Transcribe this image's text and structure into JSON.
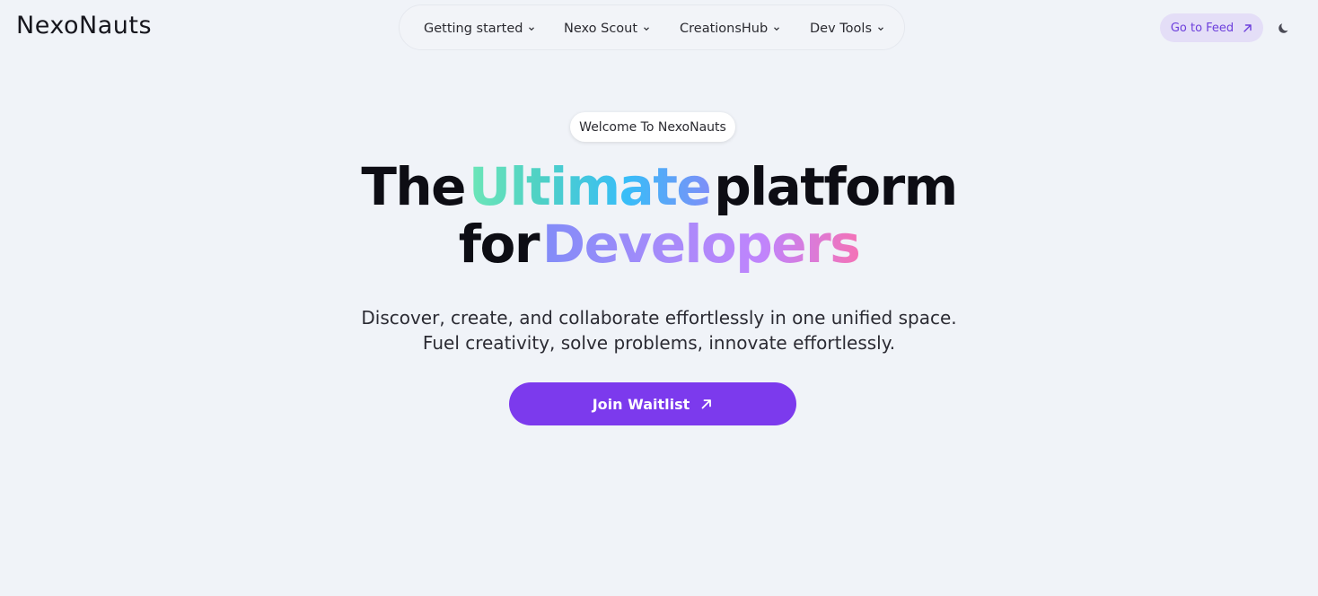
{
  "brand": {
    "logo_text": "NexoNauts"
  },
  "nav": {
    "items": [
      {
        "label": "Getting started",
        "icon": "chevron-down-icon"
      },
      {
        "label": "Nexo Scout",
        "icon": "chevron-down-icon"
      },
      {
        "label": "CreationsHub",
        "icon": "chevron-down-icon"
      },
      {
        "label": "Dev Tools",
        "icon": "chevron-down-icon"
      }
    ]
  },
  "header_actions": {
    "go_to_feed_label": "Go to Feed",
    "go_to_feed_icon": "arrow-up-right-icon",
    "theme_toggle_icon": "moon-icon"
  },
  "hero": {
    "welcome_badge": "Welcome To NexoNauts",
    "headline_part1": "The",
    "headline_highlight1": "Ultimate",
    "headline_part2": "platform",
    "headline_part3": "for",
    "headline_highlight2": "Developers",
    "subtitle_line1": "Discover, create, and collaborate effortlessly in one unified space.",
    "subtitle_line2": "Fuel creativity, solve problems, innovate effortlessly.",
    "cta_label": "Join Waitlist",
    "cta_icon": "arrow-up-right-icon"
  },
  "colors": {
    "background": "#f0f3f8",
    "accent": "#7c3aed",
    "feed_button_bg": "#e4def7",
    "feed_button_text": "#6d3fdc"
  }
}
